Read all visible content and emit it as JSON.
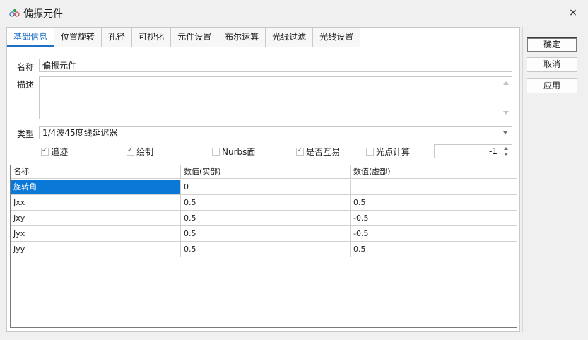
{
  "window": {
    "title": "偏振元件",
    "close_glyph": "×"
  },
  "tabs": [
    {
      "label": "基础信息",
      "active": true
    },
    {
      "label": "位置旋转",
      "active": false
    },
    {
      "label": "孔径",
      "active": false
    },
    {
      "label": "可视化",
      "active": false
    },
    {
      "label": "元件设置",
      "active": false
    },
    {
      "label": "布尔运算",
      "active": false
    },
    {
      "label": "光线过滤",
      "active": false
    },
    {
      "label": "光线设置",
      "active": false
    }
  ],
  "form": {
    "name_label": "名称",
    "name_value": "偏振元件",
    "desc_label": "描述",
    "desc_value": "",
    "type_label": "类型",
    "type_value": "1/4波45度线延迟器"
  },
  "options": {
    "trace": {
      "label": "追迹",
      "checked": true
    },
    "draw": {
      "label": "绘制",
      "checked": true
    },
    "nurbs": {
      "label": "Nurbs面",
      "checked": false
    },
    "reciprocal": {
      "label": "是否互易",
      "checked": true
    },
    "spot_calc": {
      "label": "光点计算",
      "checked": false
    },
    "spin_value": "-1"
  },
  "table": {
    "headers": [
      "名称",
      "数值(实部)",
      "数值(虚部)"
    ],
    "rows": [
      [
        "旋转角",
        "0",
        ""
      ],
      [
        "Jxx",
        "0.5",
        "0.5"
      ],
      [
        "Jxy",
        "0.5",
        "-0.5"
      ],
      [
        "Jyx",
        "0.5",
        "-0.5"
      ],
      [
        "Jyy",
        "0.5",
        "0.5"
      ]
    ]
  },
  "buttons": {
    "ok": "确定",
    "cancel": "取消",
    "apply": "应用"
  },
  "colors": {
    "accent": "#1f6fc6",
    "selection": "#0a78d7"
  }
}
